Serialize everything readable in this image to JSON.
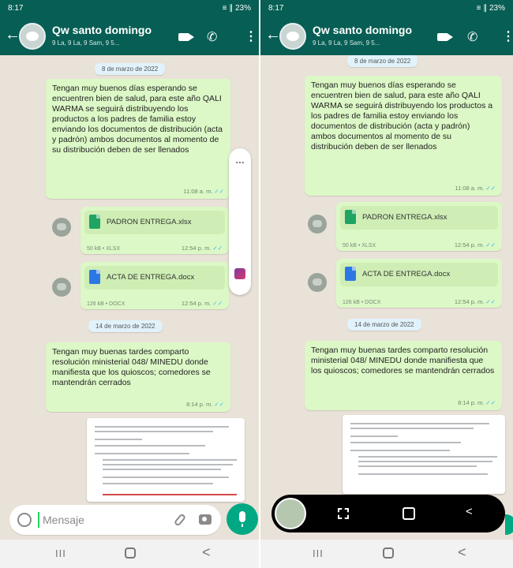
{
  "chat": {
    "title": "Qw santo domingo",
    "subtitle": "9 La, 9 La, 9 Sam, 9 5..."
  },
  "status": {
    "time": "8:17",
    "icons": "▲●■ •",
    "battery": "≡ ∥ 23%"
  },
  "dates": {
    "march8": "8 de marzo de 2022",
    "march14": "14 de marzo de 2022"
  },
  "messages": [
    {
      "text": "Tengan muy buenos días esperando se encuentren bien de salud, para este año QALI WARMA se seguirá distribuyendo los productos a los padres de familia estoy enviando los documentos de distribución (acta y padrón) ambos documentos al momento de su distribución deben de ser llenados",
      "time": "11:08 a. m."
    },
    {
      "file_name": "PADRON ENTREGA.xlsx",
      "file_meta": "50 kB • XLSX",
      "time": "12:54 p. m."
    },
    {
      "file_name": "ACTA DE ENTREGA.docx",
      "file_meta": "126 kB • DOCX",
      "time": "12:54 p. m."
    },
    {
      "text": "Tengan muy buenas tardes comparto resolución ministerial 048/ MINEDU donde manifiesta que los quioscos; comedores se mantendrán cerrados",
      "time": "8:14 p. m."
    }
  ],
  "input": {
    "placeholder": "Mensaje"
  },
  "navbar": {
    "recents": "III",
    "back": "<"
  },
  "toolbar": {
    "crop": "",
    "scroll": "",
    "share": "<"
  },
  "colors": {
    "header": "#075e54",
    "bubble_out": "#dcf8c6",
    "chat_bg": "#e9e2d8",
    "accent": "#00a884",
    "xlsx": "#1fa463",
    "docx": "#2b78e4",
    "read_ticks": "#34b7f1"
  }
}
